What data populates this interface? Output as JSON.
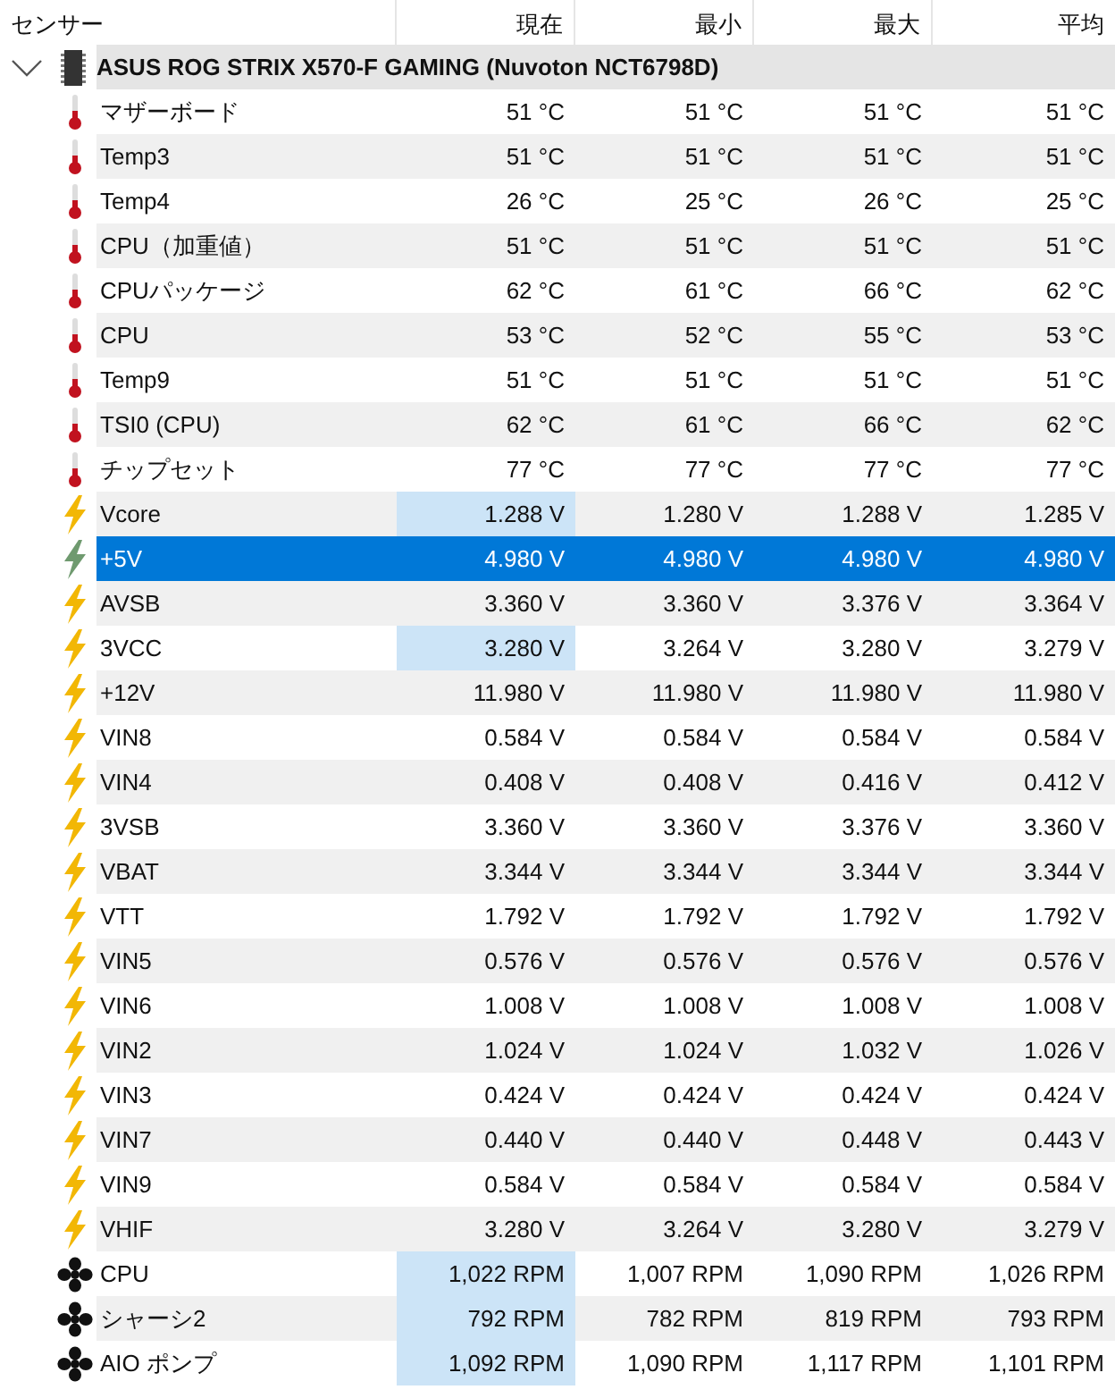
{
  "columns": [
    "センサー",
    "現在",
    "最小",
    "最大",
    "平均"
  ],
  "device": {
    "name": "ASUS ROG STRIX X570-F GAMING (Nuvoton NCT6798D)",
    "expanded": true
  },
  "rows": [
    {
      "kind": "temp",
      "name": "マザーボード",
      "values": [
        "51 °C",
        "51 °C",
        "51 °C",
        "51 °C"
      ],
      "selected": false,
      "highlighted": false
    },
    {
      "kind": "temp",
      "name": "Temp3",
      "values": [
        "51 °C",
        "51 °C",
        "51 °C",
        "51 °C"
      ],
      "selected": false,
      "highlighted": false
    },
    {
      "kind": "temp",
      "name": "Temp4",
      "values": [
        "26 °C",
        "25 °C",
        "26 °C",
        "25 °C"
      ],
      "selected": false,
      "highlighted": false
    },
    {
      "kind": "temp",
      "name": "CPU（加重値）",
      "values": [
        "51 °C",
        "51 °C",
        "51 °C",
        "51 °C"
      ],
      "selected": false,
      "highlighted": false
    },
    {
      "kind": "temp",
      "name": "CPUパッケージ",
      "values": [
        "62 °C",
        "61 °C",
        "66 °C",
        "62 °C"
      ],
      "selected": false,
      "highlighted": false
    },
    {
      "kind": "temp",
      "name": "CPU",
      "values": [
        "53 °C",
        "52 °C",
        "55 °C",
        "53 °C"
      ],
      "selected": false,
      "highlighted": false
    },
    {
      "kind": "temp",
      "name": "Temp9",
      "values": [
        "51 °C",
        "51 °C",
        "51 °C",
        "51 °C"
      ],
      "selected": false,
      "highlighted": false
    },
    {
      "kind": "temp",
      "name": "TSI0 (CPU)",
      "values": [
        "62 °C",
        "61 °C",
        "66 °C",
        "62 °C"
      ],
      "selected": false,
      "highlighted": false
    },
    {
      "kind": "temp",
      "name": "チップセット",
      "values": [
        "77 °C",
        "77 °C",
        "77 °C",
        "77 °C"
      ],
      "selected": false,
      "highlighted": false
    },
    {
      "kind": "volt",
      "name": "Vcore",
      "values": [
        "1.288 V",
        "1.280 V",
        "1.288 V",
        "1.285 V"
      ],
      "selected": false,
      "highlighted": true
    },
    {
      "kind": "volt",
      "name": "+5V",
      "values": [
        "4.980 V",
        "4.980 V",
        "4.980 V",
        "4.980 V"
      ],
      "selected": true,
      "highlighted": false
    },
    {
      "kind": "volt",
      "name": "AVSB",
      "values": [
        "3.360 V",
        "3.360 V",
        "3.376 V",
        "3.364 V"
      ],
      "selected": false,
      "highlighted": false
    },
    {
      "kind": "volt",
      "name": "3VCC",
      "values": [
        "3.280 V",
        "3.264 V",
        "3.280 V",
        "3.279 V"
      ],
      "selected": false,
      "highlighted": true
    },
    {
      "kind": "volt",
      "name": "+12V",
      "values": [
        "11.980 V",
        "11.980 V",
        "11.980 V",
        "11.980 V"
      ],
      "selected": false,
      "highlighted": false
    },
    {
      "kind": "volt",
      "name": "VIN8",
      "values": [
        "0.584 V",
        "0.584 V",
        "0.584 V",
        "0.584 V"
      ],
      "selected": false,
      "highlighted": false
    },
    {
      "kind": "volt",
      "name": "VIN4",
      "values": [
        "0.408 V",
        "0.408 V",
        "0.416 V",
        "0.412 V"
      ],
      "selected": false,
      "highlighted": false
    },
    {
      "kind": "volt",
      "name": "3VSB",
      "values": [
        "3.360 V",
        "3.360 V",
        "3.376 V",
        "3.360 V"
      ],
      "selected": false,
      "highlighted": false
    },
    {
      "kind": "volt",
      "name": "VBAT",
      "values": [
        "3.344 V",
        "3.344 V",
        "3.344 V",
        "3.344 V"
      ],
      "selected": false,
      "highlighted": false
    },
    {
      "kind": "volt",
      "name": "VTT",
      "values": [
        "1.792 V",
        "1.792 V",
        "1.792 V",
        "1.792 V"
      ],
      "selected": false,
      "highlighted": false
    },
    {
      "kind": "volt",
      "name": "VIN5",
      "values": [
        "0.576 V",
        "0.576 V",
        "0.576 V",
        "0.576 V"
      ],
      "selected": false,
      "highlighted": false
    },
    {
      "kind": "volt",
      "name": "VIN6",
      "values": [
        "1.008 V",
        "1.008 V",
        "1.008 V",
        "1.008 V"
      ],
      "selected": false,
      "highlighted": false
    },
    {
      "kind": "volt",
      "name": "VIN2",
      "values": [
        "1.024 V",
        "1.024 V",
        "1.032 V",
        "1.026 V"
      ],
      "selected": false,
      "highlighted": false
    },
    {
      "kind": "volt",
      "name": "VIN3",
      "values": [
        "0.424 V",
        "0.424 V",
        "0.424 V",
        "0.424 V"
      ],
      "selected": false,
      "highlighted": false
    },
    {
      "kind": "volt",
      "name": "VIN7",
      "values": [
        "0.440 V",
        "0.440 V",
        "0.448 V",
        "0.443 V"
      ],
      "selected": false,
      "highlighted": false
    },
    {
      "kind": "volt",
      "name": "VIN9",
      "values": [
        "0.584 V",
        "0.584 V",
        "0.584 V",
        "0.584 V"
      ],
      "selected": false,
      "highlighted": false
    },
    {
      "kind": "volt",
      "name": "VHIF",
      "values": [
        "3.280 V",
        "3.264 V",
        "3.280 V",
        "3.279 V"
      ],
      "selected": false,
      "highlighted": false
    },
    {
      "kind": "fan",
      "name": "CPU",
      "values": [
        "1,022 RPM",
        "1,007 RPM",
        "1,090 RPM",
        "1,026 RPM"
      ],
      "selected": false,
      "highlighted": true
    },
    {
      "kind": "fan",
      "name": "シャーシ2",
      "values": [
        "792 RPM",
        "782 RPM",
        "819 RPM",
        "793 RPM"
      ],
      "selected": false,
      "highlighted": true
    },
    {
      "kind": "fan",
      "name": "AIO ポンプ",
      "values": [
        "1,092 RPM",
        "1,090 RPM",
        "1,117 RPM",
        "1,101 RPM"
      ],
      "selected": false,
      "highlighted": true
    }
  ]
}
